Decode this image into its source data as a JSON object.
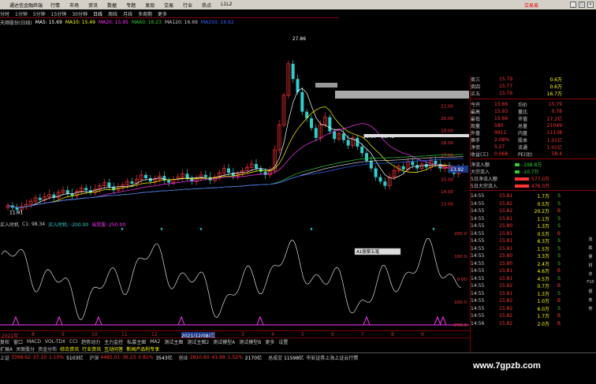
{
  "colors": {
    "up": "#ff3333",
    "down": "#33cc33",
    "white": "#ffffff",
    "yellow": "#ffff00",
    "cyan": "#33cccc",
    "magenta": "#ff33ff",
    "gray": "#808080",
    "blue": "#3366ff"
  },
  "topbar": {
    "app_title": "通达信金融终端",
    "menus": [
      "行情",
      "市场",
      "资讯",
      "数据",
      "专题",
      "发现",
      "交易",
      "行业",
      "热点",
      "L1L2"
    ],
    "right_link": "交易易"
  },
  "periods": [
    "分时",
    "1分钟",
    "5分钟",
    "15分钟",
    "30分钟",
    "日线",
    "周线",
    "月线",
    "多周期",
    "更多"
  ],
  "active_period": "日线",
  "stock_label": "天顺股份(日线)",
  "ma_labels": [
    {
      "text": "MA5: 15.69",
      "color": "#ffffff"
    },
    {
      "text": "MA10: 15.49",
      "color": "#ffff00"
    },
    {
      "text": "MA20: 15.95",
      "color": "#ff33ff"
    },
    {
      "text": "MA60: 16.23",
      "color": "#33cc33"
    },
    {
      "text": "MA120: 16.69",
      "color": "#cccccc"
    },
    {
      "text": "MA250: 16.92",
      "color": "#3366ff"
    }
  ],
  "price_labels": {
    "high": "27.86",
    "low": "11.91",
    "range": "18.60 - 18.43",
    "current": "13.92"
  },
  "price_axis": [
    "22.00",
    "21.00",
    "20.00",
    "19.00",
    "18.00",
    "17.00",
    "16.00",
    "15.00",
    "14.00",
    "13.00"
  ],
  "indicator": {
    "name": "买入时机",
    "params": "C1: 98.34",
    "line1": "买入时机: -200.00",
    "line2": "出货股: 250.00",
    "axis": [
      "300.0",
      "200.0",
      "100.0",
      "0.00",
      "-100.0",
      "-200.0"
    ],
    "tooltip_label": "A1股票五笔"
  },
  "dates": [
    "2021年",
    "8",
    "9",
    "10",
    "11",
    "12",
    "2021/12/08/三",
    "2",
    "3",
    "4",
    "5",
    "6",
    "7",
    "8",
    "9"
  ],
  "tabs_row1": [
    "复权",
    "窗口",
    "MACD",
    "VOL-TDX",
    "CCI",
    "趋势动力",
    "主力监控",
    "私募主图",
    "MA2",
    "测试主图",
    "测试主图2",
    "测试模型A",
    "测试模型B",
    "更多",
    "设置"
  ],
  "tabs_row2": [
    "扩展A",
    "关联股分",
    "资金分布",
    "综合资讯",
    "行业资讯",
    "互动问答",
    "新闻产品利专享"
  ],
  "ticker": [
    {
      "label": "上证",
      "value": "3398.62",
      "change": "37.10",
      "pct": "1.10%",
      "vol": "5103亿"
    },
    {
      "label": "沪深",
      "value": "4485.01",
      "change": "36.23",
      "pct": "0.81%",
      "vol": "3543亿"
    },
    {
      "label": "创业",
      "value": "2810.60",
      "change": "41.99",
      "pct": "1.52%",
      "vol": "2170亿"
    },
    {
      "label": "总成交",
      "value": "11598亿",
      "change": "",
      "pct": "",
      "vol": ""
    }
  ],
  "ticker_tail": "市安证券上海上证云行情",
  "watermark": "www.7gpzb.com",
  "quote": {
    "asks": [
      [
        "卖三",
        "15.79",
        "0.6万"
      ],
      [
        "卖四",
        "15.77",
        "0.6万"
      ],
      [
        "买五",
        "15.76",
        "16.7万"
      ]
    ],
    "stats": [
      [
        "今开",
        "15.66",
        "均价",
        "15.79"
      ],
      [
        "最高",
        "15.93",
        "量比",
        "0.78"
      ],
      [
        "最低",
        "15.66",
        "市值",
        "17.2亿"
      ],
      [
        "现量",
        "580",
        "总量",
        "21049"
      ],
      [
        "外盘",
        "9911",
        "内盘",
        "11138"
      ],
      [
        "换手",
        "2.08%",
        "股本",
        "1.01亿"
      ],
      [
        "净资",
        "5.27",
        "流通",
        "1.01亿"
      ],
      [
        "收益(三)",
        "0.068",
        "PE(动)",
        "58.4"
      ]
    ],
    "flows": [
      [
        "净流入额",
        "-198.8万"
      ],
      [
        "大宗流入",
        "-10.7万"
      ],
      [
        "5日净流入额",
        "577.0万"
      ],
      [
        "5日大宗流入",
        "476.0万"
      ]
    ],
    "ticks": [
      [
        "14:55",
        "15.81",
        "1.7万",
        "S"
      ],
      [
        "14:55",
        "15.82",
        "0.5万",
        "S"
      ],
      [
        "14:55",
        "15.82",
        "20.2万",
        "B"
      ],
      [
        "14:55",
        "15.81",
        "1.1万",
        "S"
      ],
      [
        "14:55",
        "15.80",
        "1.3万",
        "S"
      ],
      [
        "14:55",
        "15.81",
        "0.5万",
        "B"
      ],
      [
        "14:55",
        "15.81",
        "6.3万",
        "S"
      ],
      [
        "14:55",
        "15.81",
        "1.5万",
        "S"
      ],
      [
        "14:55",
        "15.80",
        "3.3万",
        "S"
      ],
      [
        "14:55",
        "15.80",
        "2.4万",
        "S"
      ],
      [
        "14:55",
        "15.81",
        "4.6万",
        "B"
      ],
      [
        "14:55",
        "15.81",
        "4.5万",
        "S"
      ],
      [
        "14:55",
        "15.82",
        "0.7万",
        "B"
      ],
      [
        "14:55",
        "15.81",
        "1.3万",
        "S"
      ],
      [
        "14:55",
        "15.82",
        "1.0万",
        "B"
      ],
      [
        "14:55",
        "15.82",
        "6.0万",
        "S"
      ],
      [
        "14:55",
        "15.82",
        "1.7万",
        "B"
      ],
      [
        "14:56",
        "15.82",
        "2.0万",
        "B"
      ]
    ],
    "scroll_labels": [
      "涨",
      "跌",
      "量",
      "财",
      "资",
      "F10",
      "额",
      "筹",
      "势"
    ]
  },
  "chart_data": {
    "type": "candlestick",
    "title": "天顺股份(日线)",
    "ylim": [
      11.5,
      28.5
    ],
    "high_label": 27.86,
    "low_label": 11.91,
    "closes": [
      12.4,
      12.2,
      12.0,
      12.3,
      12.5,
      12.8,
      13.1,
      12.9,
      13.2,
      13.4,
      13.1,
      13.6,
      13.8,
      13.5,
      13.3,
      13.7,
      14.0,
      13.8,
      13.6,
      13.9,
      14.2,
      14.5,
      14.1,
      13.8,
      14.0,
      14.3,
      14.6,
      14.4,
      14.8,
      15.2,
      14.9,
      14.6,
      14.8,
      15.1,
      14.7,
      14.5,
      14.8,
      15.0,
      15.3,
      14.9,
      14.6,
      14.9,
      15.2,
      15.0,
      14.7,
      15.0,
      15.4,
      15.8,
      15.4,
      15.1,
      15.3,
      15.6,
      15.9,
      16.2,
      15.8,
      15.5,
      15.2,
      15.6,
      17.5,
      19.8,
      22.5,
      25.4,
      24.0,
      22.8,
      21.0,
      20.4,
      19.5,
      18.6,
      19.8,
      20.5,
      19.2,
      18.5,
      19.0,
      18.4,
      17.9,
      18.6,
      17.8,
      17.2,
      16.5,
      15.8,
      15.0,
      14.6,
      14.2,
      15.0,
      15.6,
      16.0,
      15.7,
      16.4,
      16.1,
      15.8,
      16.2,
      15.9,
      16.5,
      16.2,
      15.8,
      16.1,
      15.6,
      15.3,
      15.8,
      15.7
    ],
    "series": [
      {
        "name": "MA5",
        "color": "#ffffff"
      },
      {
        "name": "MA10",
        "color": "#ffff00"
      },
      {
        "name": "MA20",
        "color": "#ff33ff"
      },
      {
        "name": "MA60",
        "color": "#33cc33"
      },
      {
        "name": "MA120",
        "color": "#cccccc"
      },
      {
        "name": "MA250",
        "color": "#3366ff"
      }
    ]
  }
}
